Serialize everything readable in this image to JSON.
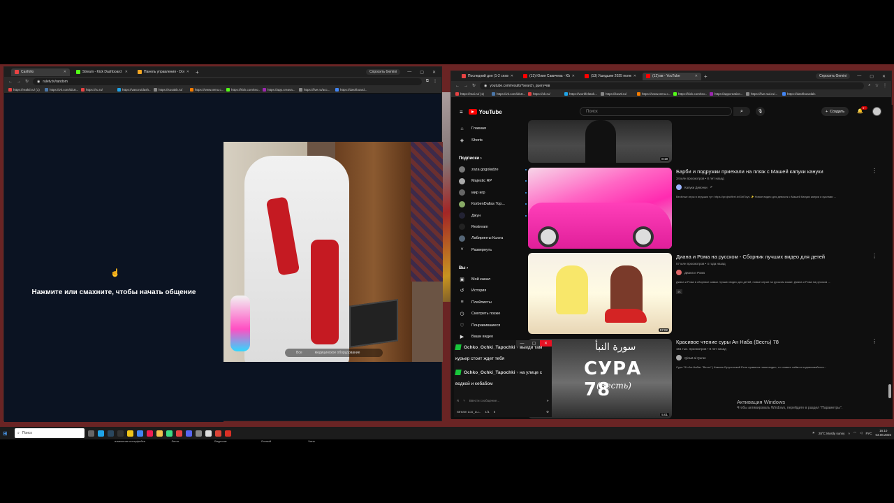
{
  "left_browser": {
    "tabs": [
      {
        "label": "Сапfolio",
        "color": "#e84343"
      },
      {
        "label": "Stream - Kick Dashboard",
        "color": "#53fc18"
      },
      {
        "label": "Панель управления - DonationAlerts",
        "color": "#f5a623"
      }
    ],
    "gemini_label": "Спросить Gemini",
    "url": "ruletv.tv/random",
    "bookmarks": [
      "https://reaktl.ru/ (1)",
      "https://vk.com/id18...",
      "https://ru.ru/",
      "https://vast.ru/dash...",
      "https://sosakb.ru/",
      "https://www.temu.c...",
      "https://kick.com/teo...",
      "https://app.creava...",
      "https://live.ru/acc...",
      "https://dashboard..."
    ],
    "chat": {
      "start_text": "Нажмите или смахните, чтобы начать общение",
      "hand_icon": "hand-icon"
    },
    "cam_pill": {
      "left": "Все",
      "right": "медицинское оборудование"
    },
    "bottom_nav": [
      {
        "label": "изменение интерфейса",
        "icon": "person-icon"
      },
      {
        "label": "Ленте",
        "icon": "chat-icon"
      },
      {
        "label": "Видеочат",
        "icon": "video-icon"
      },
      {
        "label": "Личный",
        "icon": "message-icon"
      },
      {
        "label": "Чаты",
        "icon": "chats-icon"
      }
    ]
  },
  "right_browser": {
    "tabs": [
      {
        "label": "Последний доп (1-2 сезон) сп...",
        "color": "#e84343"
      },
      {
        "label": "(13) Юлия Савичева - Юлия",
        "color": "#ff0000"
      },
      {
        "label": "(13) Ушедшие 2025 полный д...",
        "color": "#ff0000"
      },
      {
        "label": "(12) вв - YouTube",
        "color": "#ff0000"
      }
    ],
    "gemini_label": "Спросить Gemini",
    "url": "youtube.com/results?search_query=вв",
    "bookmarks": [
      "https://mai.ru/ (1)",
      "https://vk.com/id18...",
      "https://ok.ru/",
      "https://workfeltank...",
      "https://kowtl.ru/",
      "https://www.temu.c...",
      "https://kick.com/teo...",
      "https://appcreative...",
      "https://live.rad.ru/...",
      "https://dashboardalc..."
    ]
  },
  "youtube": {
    "logo_text": "YouTube",
    "search_placeholder": "Поиск",
    "create_label": "Создать",
    "notif_count": "9+",
    "sidebar_top": [
      {
        "label": "Главная",
        "icon": "home-icon",
        "glyph": "⌂"
      },
      {
        "label": "Shorts",
        "icon": "shorts-icon",
        "glyph": "◈"
      }
    ],
    "subs_header": "Подписки",
    "subs": [
      "zaza gogoladze",
      "Majestic RP",
      "мир игр",
      "KorbenDallas Top...",
      "Джун",
      "Restream",
      "Лабиринты Кьюга"
    ],
    "expand_label": "Развернуть",
    "you_header": "Вы",
    "you_items": [
      {
        "label": "Мой канал",
        "glyph": "▣"
      },
      {
        "label": "История",
        "glyph": "↺"
      },
      {
        "label": "Плейлисты",
        "glyph": "≡"
      },
      {
        "label": "Смотреть позже",
        "glyph": "◷"
      },
      {
        "label": "Понравившиеся",
        "glyph": "♡"
      },
      {
        "label": "Ваши видео",
        "glyph": "▶"
      }
    ],
    "videos": [
      {
        "duration": "8:19"
      },
      {
        "title": "Барби и подружки приехали на пляж с Машей капуки кануки",
        "meta": "34 млн просмотров • 8 лет назад",
        "channel": "Капуки Девочки",
        "desc": "Весёлые игры в игрушки тут: https://project9rel.tv/GirlToys ✨ Новое видео для девочек с Машей Капуки кануки и куклами ...",
        "duration": ""
      },
      {
        "title": "Диана и Рома на русском - Сборник лучших видео для детей",
        "meta": "57 млн просмотров • 4 года назад",
        "channel": "Диана и Рома",
        "desc": "Диана и Рома в сборнике самых лучших видео для детей, новые серии на русском языке. Диана и Рома на русском ...",
        "badge": "4K",
        "duration": "57:02"
      },
      {
        "title": "Красивое чтение суры Ан Наба (Весть) 78",
        "meta": "161 тыс. просмотров • 8 лет назад",
        "channel": "Qiraat al Quran",
        "desc": "Сура 78 «Ан-Наба» \"Весть\" | Камиль Бугучинский Если нравятся наши видео, то ставьте лайки и подписывайтесь...",
        "duration": "5:01",
        "thumb_arabic": "سورة النبأ",
        "thumb_title": "СУРА 78",
        "thumb_sub": "(Весть)"
      }
    ]
  },
  "chat_overlay": {
    "messages": [
      {
        "user": "Ochko_Ochki_Tapochki",
        "chev": "˅",
        "text": "выиди там курьер стоит ждет тебя"
      },
      {
        "user": "Ochko_Ochki_Tapochki",
        "chev": "˅",
        "text": "на улице с водкой и кебабом"
      }
    ],
    "input_placeholder": "Ввести сообщение...",
    "footer": {
      "app": "Stream Loo_Lu...",
      "count1": "1/1",
      "count2": "5"
    }
  },
  "windows": {
    "activation_title": "Активация Windows",
    "activation_sub": "Чтобы активировать Windows, перейдите в раздел \"Параметры\".",
    "search_label": "Поиск",
    "weather": "28°C  Mostly sunny",
    "lang": "РУС",
    "time": "16:10",
    "date": "03.08.2025"
  }
}
